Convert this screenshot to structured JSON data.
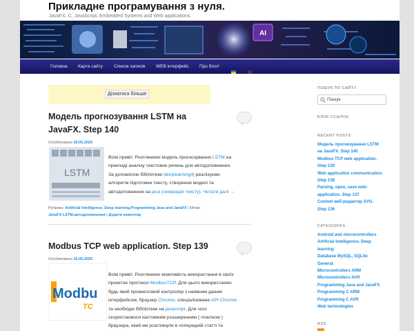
{
  "site": {
    "title": "Прикладне програмування з нуля.",
    "description": "JavaFX, C, JavaScript, Embedded Systems and Web applications."
  },
  "nav": {
    "items": [
      "Головна",
      "Карта сайту",
      "Список записів",
      "WEB інтерфейс",
      "Про блог!"
    ]
  },
  "ad": {
    "button_label": "Дізнатися більше"
  },
  "posts": [
    {
      "title_line1": "Модель прогнозування LSTM на",
      "title_line2": "JavaFX. Step 140",
      "meta_prefix": "Опубліковано",
      "date": "29.05.2026",
      "excerpt": [
        {
          "t": "Всім привіт. Розглянемо модель прогнозування ",
          "l": "LSTM",
          "r": " на"
        },
        {
          "t": "прикладі аналізу текстових речень для автодоповнення.",
          "l": "",
          "r": ""
        },
        {
          "t": "За допомогою бібліотеки ",
          "l": "deeplearning4j",
          "r": " реалізуємо"
        },
        {
          "t": "алгоритм підготовки тексту, створення моделі та",
          "l": "",
          "r": ""
        },
        {
          "t": "автодоповнення на ",
          "l": "java (генерація тексту)",
          "r": ". "
        }
      ],
      "read_more": "Читати далі →",
      "rubric_label": "Рубрика:",
      "rubrics": "Artificial Intelligence, Deep learning,Programming Java and JavaFX",
      "tags_label": "| Мітки:",
      "tags": "JavaFX LSTM,автодоповнення",
      "comment": "Додати коментар"
    },
    {
      "title_line1": "Modbus TCP web application. Step 139",
      "meta_prefix": "Опубліковано",
      "date": "16.06.2025",
      "excerpt": [
        {
          "t": "Всім привіт. Розглянемо можливість використання в своїх",
          "l": "",
          "r": ""
        },
        {
          "t": "проектах протокол ",
          "l": "ModbusTCP",
          "r": ". Для цього використаємо"
        },
        {
          "t": "будь який промисловий контролер з наявним даним",
          "l": "",
          "r": ""
        },
        {
          "t": "інтерфейсом, браузер ",
          "l": "Chrome",
          "r": ", спеціалізоване "
        },
        {
          "t": "та необхідні бібліотеки на ",
          "l": "javascript",
          "r": ". Для чого"
        },
        {
          "t": "скористаємося кастомним розширенням ( плагіном )",
          "l": "",
          "r": ""
        },
        {
          "t": "браузера, який ми розглянули в попередній статті та",
          "l": "",
          "r": ""
        }
      ],
      "api_link": "API Chrome",
      "thumb_text": "Modbu",
      "thumb_sub": "TC"
    }
  ],
  "sidebar": {
    "search_heading": "ПОШУК ПО САЙТУ",
    "search_placeholder": "Пошук",
    "links_heading": "БЛОК ССЫЛОК",
    "recent_heading": "RECENT POSTS",
    "recent": [
      [
        "Модель прогнозування LSTM",
        "на JavaFX. Step 140"
      ],
      [
        "Modbus TCP web application.",
        "Step 139"
      ],
      [
        "Web application communication.",
        "Step 138"
      ],
      [
        "Parsing, open, save web-",
        "application. Step 137"
      ],
      [
        "Custom веб-редактор SVG.",
        "Step 136"
      ]
    ],
    "categories_heading": "CATEGORIES",
    "categories": [
      [
        "Android and microcontrollers"
      ],
      [
        "Artificial Intelligence, Deep",
        "learning"
      ],
      [
        "Database MySQL, SQLite"
      ],
      [
        "General"
      ],
      [
        "Microcontrollers ARM"
      ],
      [
        "Microcontrollers AVR"
      ],
      [
        "Programming Java and JavaFX"
      ],
      [
        "Programming C ARM"
      ],
      [
        "Programming C AVR"
      ],
      [
        "Web technologies"
      ]
    ],
    "rss_heading": "RSS"
  },
  "colors": {
    "link": "#1b8be0",
    "nav": "#1f1f78",
    "ad_bg": "#fdf7c6"
  }
}
